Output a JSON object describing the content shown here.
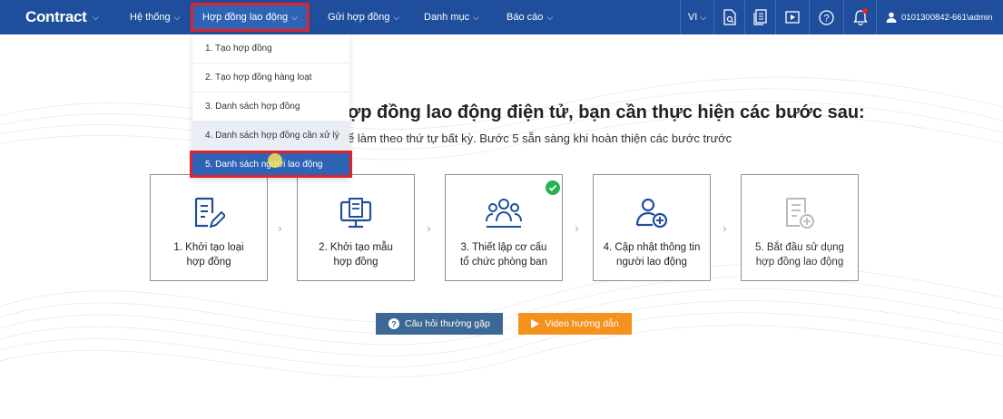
{
  "app": {
    "logo": "Contract"
  },
  "nav": {
    "items": [
      {
        "label": "Hệ thống"
      },
      {
        "label": "Hợp đồng lao động"
      },
      {
        "label": "Gửi hợp đồng"
      },
      {
        "label": "Danh mục"
      },
      {
        "label": "Báo cáo"
      }
    ],
    "language": "VI",
    "account": "0101300842-661\\admin"
  },
  "dropdown": {
    "items": [
      {
        "label": "1. Tạo hợp đồng"
      },
      {
        "label": "2. Tạo hợp đồng hàng loạt"
      },
      {
        "label": "3. Danh sách hợp đồng"
      },
      {
        "label": "4. Danh sách hợp đồng cần xử lý"
      },
      {
        "label": "5. Danh sách người lao động"
      }
    ]
  },
  "main": {
    "heading": "ợp đồng lao động điện tử, bạn cần thực hiện các bước sau:",
    "subheading": "ể làm theo thứ tự bất kỳ. Bước 5 sẵn sàng khi hoàn thiện các bước trước",
    "steps": [
      {
        "label": "1. Khởi tạo loại\nhợp đồng",
        "icon": "document-edit-icon"
      },
      {
        "label": "2. Khởi tạo mẫu\nhợp đồng",
        "icon": "monitor-document-icon"
      },
      {
        "label": "3. Thiết lập cơ cấu\ntổ chức phòng ban",
        "icon": "users-group-icon",
        "completed": true
      },
      {
        "label": "4. Cập nhật thông tin\nngười lao động",
        "icon": "user-add-icon"
      },
      {
        "label": "5. Bắt đầu sử dụng\nhợp đồng lao động",
        "icon": "document-add-icon",
        "disabled": true
      }
    ],
    "buttons": {
      "faq": "Câu hỏi thường gặp",
      "video": "Video hướng dẫn"
    }
  },
  "colors": {
    "topbar": "#1f4f9c",
    "highlight_border": "#e0222b",
    "accent_icon": "#1f4f9c",
    "success": "#27b14f",
    "faq_button": "#3d6896",
    "video_button": "#f5921e"
  }
}
